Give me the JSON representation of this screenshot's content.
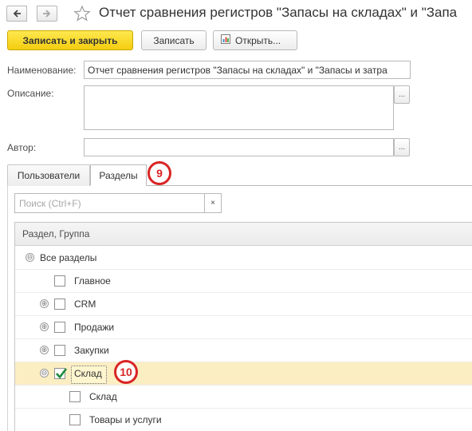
{
  "window": {
    "title": "Отчет сравнения регистров \"Запасы на складах\" и \"Запа"
  },
  "toolbar": {
    "save_close_label": "Записать и закрыть",
    "save_label": "Записать",
    "open_label": "Открыть..."
  },
  "form": {
    "name_label": "Наименование:",
    "name_value": "Отчет сравнения регистров \"Запасы на складах\" и \"Запасы и затра",
    "description_label": "Описание:",
    "description_value": "",
    "author_label": "Автор:",
    "author_value": "",
    "select_button": "..."
  },
  "tabs": [
    {
      "label": "Пользователи",
      "active": false
    },
    {
      "label": "Разделы",
      "active": true
    }
  ],
  "callouts": {
    "tabs": "9",
    "row": "10"
  },
  "search": {
    "placeholder": "Поиск (Ctrl+F)",
    "clear": "×"
  },
  "grid": {
    "column_header": "Раздел, Группа",
    "rows": [
      {
        "label": "Все разделы",
        "level": 0,
        "expander": "⊖",
        "checkbox": false,
        "checked": false
      },
      {
        "label": "Главное",
        "level": 1,
        "expander": "",
        "checkbox": true,
        "checked": false
      },
      {
        "label": "CRM",
        "level": 1,
        "expander": "⊕",
        "checkbox": true,
        "checked": false
      },
      {
        "label": "Продажи",
        "level": 1,
        "expander": "⊕",
        "checkbox": true,
        "checked": false
      },
      {
        "label": "Закупки",
        "level": 1,
        "expander": "⊕",
        "checkbox": true,
        "checked": false
      },
      {
        "label": "Склад",
        "level": 1,
        "expander": "⊖",
        "checkbox": true,
        "checked": true,
        "selected": true
      },
      {
        "label": "Склад",
        "level": 2,
        "expander": "",
        "checkbox": true,
        "checked": false
      },
      {
        "label": "Товары и услуги",
        "level": 2,
        "expander": "",
        "checkbox": true,
        "checked": false
      }
    ]
  },
  "colors": {
    "primary_button": "#f3cd0f",
    "selected_row": "#fbeec3",
    "callout": "#d92424",
    "checkmark": "#1f8a3a"
  }
}
